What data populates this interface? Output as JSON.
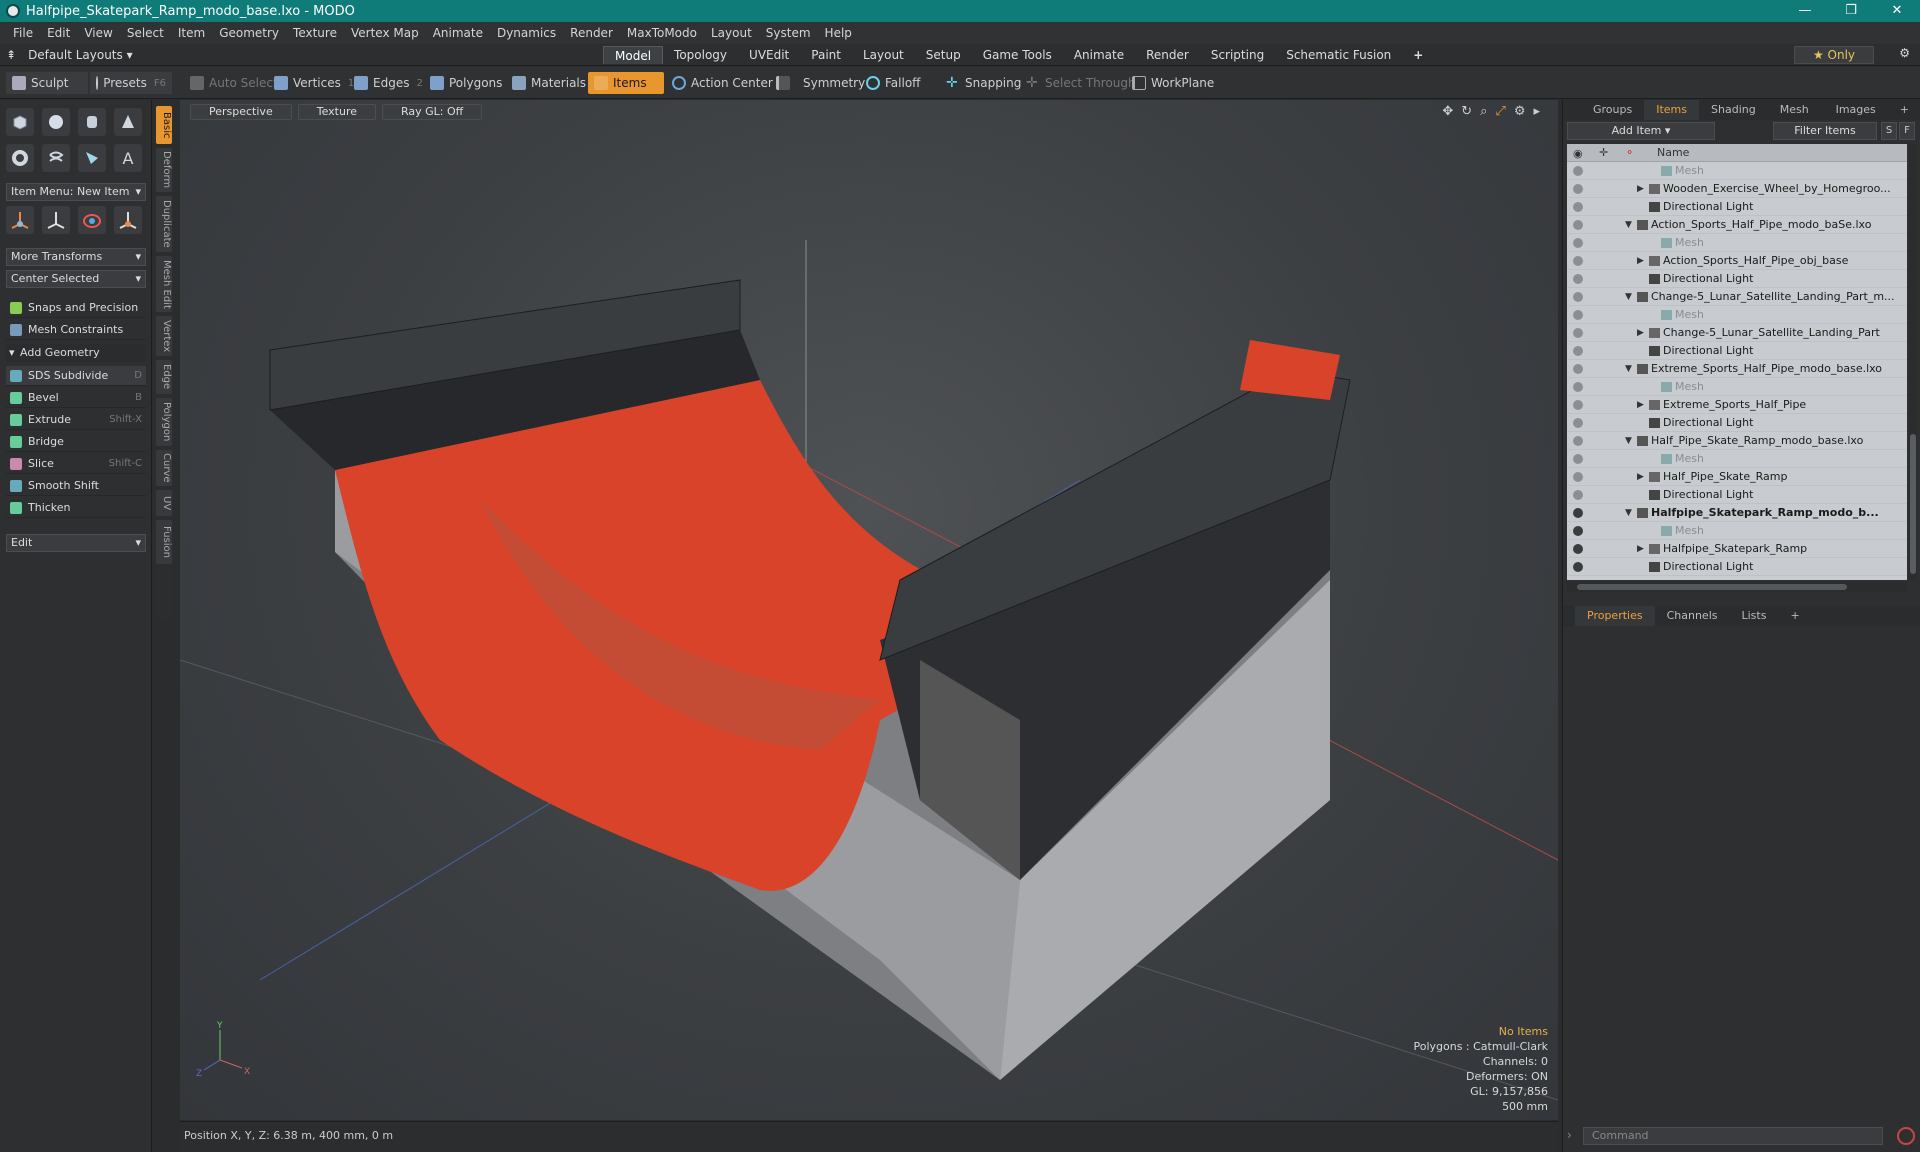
{
  "window": {
    "title": "Halfpipe_Skatepark_Ramp_modo_base.lxo - MODO",
    "controls": [
      "—",
      "❐",
      "✕"
    ]
  },
  "menu": [
    "File",
    "Edit",
    "View",
    "Select",
    "Item",
    "Geometry",
    "Texture",
    "Vertex Map",
    "Animate",
    "Dynamics",
    "Render",
    "MaxToModo",
    "Layout",
    "System",
    "Help"
  ],
  "layoutbar": {
    "default_layouts": "Default Layouts ▾",
    "tabs": [
      "Model",
      "Topology",
      "UVEdit",
      "Paint",
      "Layout",
      "Setup",
      "Game Tools",
      "Animate",
      "Render",
      "Scripting",
      "Schematic Fusion",
      "+"
    ],
    "active_tab": "Model",
    "only": "★ Only"
  },
  "toolbar": {
    "sculpt": "Sculpt",
    "presets": "Presets",
    "presets_key": "F6",
    "auto_select": "Auto Select",
    "vertices": "Vertices",
    "vertices_key": "1",
    "edges": "Edges",
    "edges_key": "2",
    "polygons": "Polygons",
    "materials": "Materials",
    "items": "Items",
    "action_center": "Action Center",
    "symmetry": "Symmetry",
    "falloff": "Falloff",
    "snapping": "Snapping",
    "select_through": "Select Through",
    "workplane": "WorkPlane"
  },
  "left": {
    "vtabs": [
      "Basic",
      "Deform",
      "Duplicate",
      "Mesh Edit",
      "Vertex",
      "Edge",
      "Polygon",
      "Curve",
      "UV",
      "Fusion"
    ],
    "item_menu": "Item Menu: New Item",
    "more_transforms": "More Transforms",
    "center_selected": "Center Selected",
    "snaps": "Snaps and Precision",
    "mesh_constraints": "Mesh Constraints",
    "add_geometry": "Add Geometry",
    "tools": [
      {
        "label": "SDS Subdivide",
        "key": "D"
      },
      {
        "label": "Bevel",
        "key": "B"
      },
      {
        "label": "Extrude",
        "key": "Shift-X"
      },
      {
        "label": "Bridge",
        "key": ""
      },
      {
        "label": "Slice",
        "key": "Shift-C"
      },
      {
        "label": "Smooth Shift",
        "key": ""
      },
      {
        "label": "Thicken",
        "key": ""
      }
    ],
    "edit": "Edit"
  },
  "viewport": {
    "view": "Perspective",
    "shading": "Texture",
    "raygl": "Ray GL: Off",
    "info": {
      "no_items": "No Items",
      "polygons": "Polygons : Catmull-Clark",
      "channels": "Channels: 0",
      "deformers": "Deformers: ON",
      "gl": "GL: 9,157,856",
      "grid": "500 mm"
    },
    "axes": {
      "y": "Y",
      "x": "X",
      "z": "Z"
    }
  },
  "status": {
    "position": "Position X, Y, Z:  6.38 m, 400 mm, 0 m"
  },
  "right": {
    "tabs": [
      "Groups",
      "Items",
      "Shading",
      "Mesh ...",
      "Images",
      "+"
    ],
    "active_tab": "Items",
    "add_item": "Add Item",
    "filter": "Filter Items",
    "s": "S",
    "f": "F",
    "col_name": "Name",
    "rows": [
      {
        "label": "Mesh",
        "indent": 3,
        "kind": "mesh",
        "dim": true,
        "tri": false
      },
      {
        "label": "Wooden_Exercise_Wheel_by_Homegroo...",
        "indent": 2,
        "kind": "group",
        "tri": true
      },
      {
        "label": "Directional Light",
        "indent": 2,
        "kind": "light"
      },
      {
        "label": "Action_Sports_Half_Pipe_modo_baSe.lxo",
        "indent": 1,
        "kind": "scene",
        "tri": true,
        "open": true
      },
      {
        "label": "Mesh",
        "indent": 3,
        "kind": "mesh",
        "dim": true
      },
      {
        "label": "Action_Sports_Half_Pipe_obj_base",
        "indent": 2,
        "kind": "group",
        "tri": true
      },
      {
        "label": "Directional Light",
        "indent": 2,
        "kind": "light"
      },
      {
        "label": "Change-5_Lunar_Satellite_Landing_Part_m...",
        "indent": 1,
        "kind": "scene",
        "tri": true,
        "open": true
      },
      {
        "label": "Mesh",
        "indent": 3,
        "kind": "mesh",
        "dim": true
      },
      {
        "label": "Change-5_Lunar_Satellite_Landing_Part",
        "indent": 2,
        "kind": "group",
        "tri": true
      },
      {
        "label": "Directional Light",
        "indent": 2,
        "kind": "light"
      },
      {
        "label": "Extreme_Sports_Half_Pipe_modo_base.lxo",
        "indent": 1,
        "kind": "scene",
        "tri": true,
        "open": true
      },
      {
        "label": "Mesh",
        "indent": 3,
        "kind": "mesh",
        "dim": true
      },
      {
        "label": "Extreme_Sports_Half_Pipe",
        "indent": 2,
        "kind": "group",
        "tri": true
      },
      {
        "label": "Directional Light",
        "indent": 2,
        "kind": "light"
      },
      {
        "label": "Half_Pipe_Skate_Ramp_modo_base.lxo",
        "indent": 1,
        "kind": "scene",
        "tri": true,
        "open": true
      },
      {
        "label": "Mesh",
        "indent": 3,
        "kind": "mesh",
        "dim": true
      },
      {
        "label": "Half_Pipe_Skate_Ramp",
        "indent": 2,
        "kind": "group",
        "tri": true
      },
      {
        "label": "Directional Light",
        "indent": 2,
        "kind": "light"
      },
      {
        "label": "Halfpipe_Skatepark_Ramp_modo_b...",
        "indent": 1,
        "kind": "scene",
        "tri": true,
        "open": true,
        "bold": true,
        "visible": true
      },
      {
        "label": "Mesh",
        "indent": 3,
        "kind": "mesh",
        "dim": true,
        "visible": true
      },
      {
        "label": "Halfpipe_Skatepark_Ramp",
        "indent": 2,
        "kind": "group",
        "tri": true,
        "visible": true
      },
      {
        "label": "Directional Light",
        "indent": 2,
        "kind": "light",
        "visible": true
      }
    ],
    "bottom_tabs": [
      "Properties",
      "Channels",
      "Lists",
      "+"
    ],
    "bottom_active": "Properties",
    "command": "Command"
  },
  "colors": {
    "accent": "#e8962e",
    "title_bar": "#0f7c7a",
    "ramp_red": "#d8432a"
  }
}
